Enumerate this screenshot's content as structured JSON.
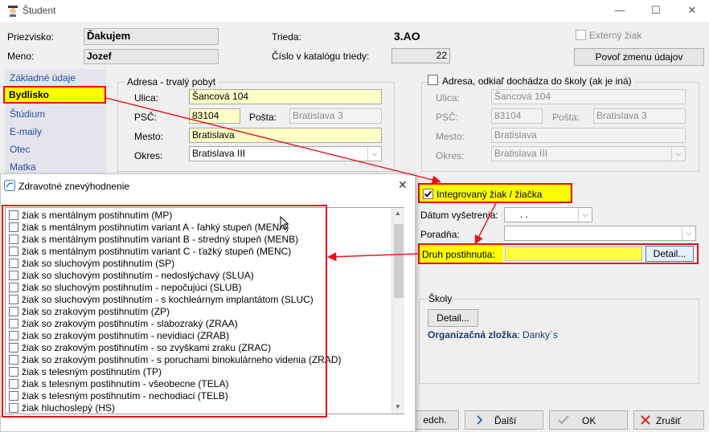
{
  "window": {
    "title": "Študent",
    "minimize": "—",
    "maximize": "☐",
    "close": "✕"
  },
  "header": {
    "surname_label": "Priezvisko:",
    "surname_value": "Ďakujem",
    "name_label": "Meno:",
    "name_value": "Jozef",
    "class_label": "Trieda:",
    "class_value": "3.AO",
    "catalog_label": "Číslo v katalógu triedy:",
    "catalog_value": "22",
    "external_label": "Externý žiak",
    "allow_change_button": "Povoľ zmenu údajov"
  },
  "nav": {
    "items": [
      "Základné údaje",
      "Bydlisko",
      "Štúdium",
      "E-maily",
      "Otec",
      "Matka"
    ]
  },
  "address_permanent": {
    "title": "Adresa - trvalý pobyt",
    "street_label": "Ulica:",
    "street_value": "Šancová 104",
    "psc_label": "PSČ:",
    "psc_value": "83104",
    "post_label": "Pošta:",
    "post_value": "Bratislava 3",
    "city_label": "Mesto:",
    "city_value": "Bratislava",
    "district_label": "Okres:",
    "district_value": "Bratislava III"
  },
  "address_temporary": {
    "title": "Adresa, odkiaľ dochádza do školy (ak je iná)",
    "street_label": "Ulica:",
    "street_value": "Šancová 104",
    "psc_label": "PSČ:",
    "psc_value": "83104",
    "post_label": "Pošta:",
    "post_value": "Bratislava 3",
    "city_label": "Mesto:",
    "city_value": "Bratislava",
    "district_label": "Okres:",
    "district_value": "Bratislava III"
  },
  "integration": {
    "checkbox_label": "Integrovaný žiak / žiačka",
    "exam_date_label": "Dátum vyšetrenia:",
    "exam_date_value": ". .",
    "counseling_label": "Poradňa:",
    "counseling_value": "",
    "disability_label": "Druh postihnutia:",
    "disability_value": "",
    "detail_button": "Detail..."
  },
  "schools": {
    "title": "Školy",
    "detail_button": "Detail...",
    "org_label": "Organizačná zložka",
    "org_value": ": Danky`s"
  },
  "footer": {
    "prev_button": "edch.",
    "next_button": "Ďalší",
    "ok_button": "OK",
    "cancel_button": "Zrušiť"
  },
  "dialog": {
    "title": "Zdravotné znevýhodnenie",
    "close": "✕",
    "items": [
      "žiak s mentálnym postihnutím (MP)",
      "žiak s mentálnym postihnutím variant A - ľahký stupeň (MENA)",
      "žiak s mentálnym postihnutím variant B - stredný stupeň (MENB)",
      "žiak s mentálnym postihnutím variant C - ťažký stupeň (MENC)",
      "žiak so sluchovým postihnutím (SP)",
      "žiak so sluchovým postihnutím - nedoslýchavý (SLUA)",
      "žiak so sluchovým postihnutím - nepočujúci (SLUB)",
      "žiak so sluchovým postihnutím - s kochleárnym implantátom (SLUC)",
      "žiak so zrakovým postihnutím (ZP)",
      "žiak so zrakovým postihnutím - slabozraký (ZRAA)",
      "žiak so zrakovým postihnutím - nevidiaci (ZRAB)",
      "žiak so zrakovým postihnutím - so zvyškami zraku (ZRAC)",
      "žiak so zrakovým postihnutím - s poruchami binokulárneho videnia (ZRAD)",
      "žiak s telesným postihnutím (TP)",
      "žiak s telesným postihnutím - všeobecne (TELA)",
      "žiak s telesným postihnutím - nechodiaci (TELB)",
      "žiak hluchoslepý (HS)"
    ]
  },
  "colors": {
    "highlight_red": "#e8101a",
    "field_yellow": "#ffffc8",
    "nav_link": "#2a4ea0"
  }
}
